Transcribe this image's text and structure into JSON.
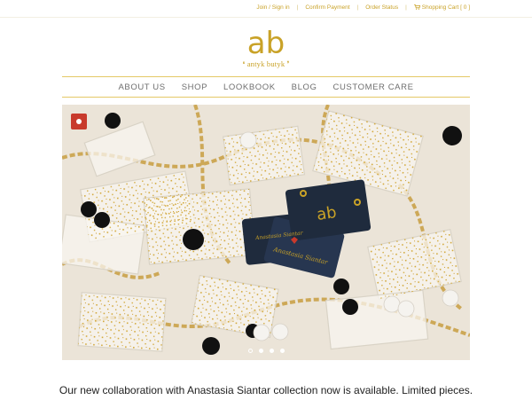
{
  "top_links": {
    "join": "Join / Sign in",
    "confirm": "Confirm Payment",
    "order": "Order Status",
    "cart": "Shopping Cart [ 0 ]",
    "separator": "|"
  },
  "logo": {
    "mark": "ab",
    "tagline": "❛ antyk butyk ❜"
  },
  "nav": {
    "items": [
      "ABOUT US",
      "SHOP",
      "LOOKBOOK",
      "BLOG",
      "CUSTOMER CARE"
    ]
  },
  "hero": {
    "card_text": "Anastasia Siantar",
    "card_logo": "ab",
    "slide_count": 4,
    "active_slide": 1
  },
  "announcement": "Our new collaboration with Anastasia Siantar collection now is available. Limited pieces.",
  "colors": {
    "accent": "#c9a227",
    "nav_text": "#6e6e6e",
    "card": "#1f2b3d"
  }
}
